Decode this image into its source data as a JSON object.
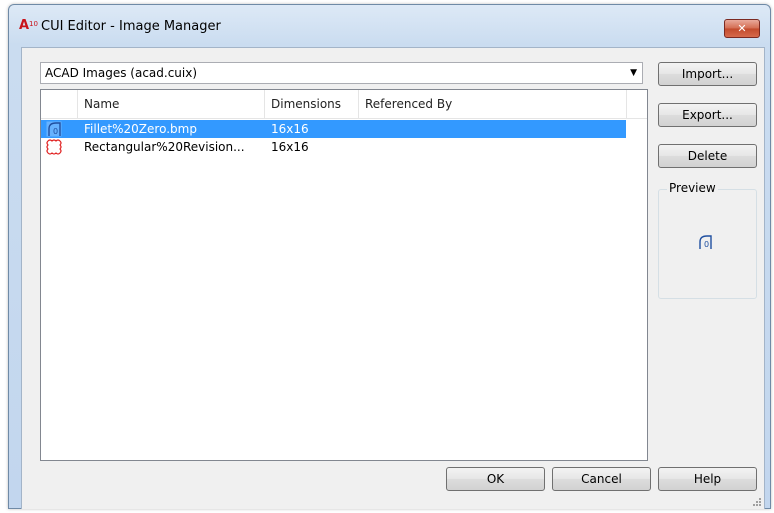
{
  "window": {
    "title": "CUI Editor - Image Manager",
    "app_icon_text": "A",
    "app_icon_version": "10",
    "close_label": "✕"
  },
  "source_combo": {
    "selected": "ACAD Images (acad.cuix)",
    "arrow": "▼"
  },
  "buttons": {
    "import": "Import...",
    "export": "Export...",
    "delete": "Delete",
    "ok": "OK",
    "cancel": "Cancel",
    "help": "Help"
  },
  "list": {
    "columns": [
      "Name",
      "Dimensions",
      "Referenced By"
    ],
    "rows": [
      {
        "icon": "fillet-zero-icon",
        "name": "Fillet%20Zero.bmp",
        "dimensions": "16x16",
        "referenced_by": "",
        "selected": true
      },
      {
        "icon": "rectangular-revision-cloud-icon",
        "name": "Rectangular%20Revision...",
        "dimensions": "16x16",
        "referenced_by": "",
        "selected": false
      }
    ]
  },
  "preview": {
    "label": "Preview",
    "icon": "fillet-zero-icon"
  },
  "colors": {
    "selection": "#3399ff",
    "close_button": "#c24a2c",
    "app_icon": "#c8141b",
    "revision_cloud": "#e02020"
  }
}
